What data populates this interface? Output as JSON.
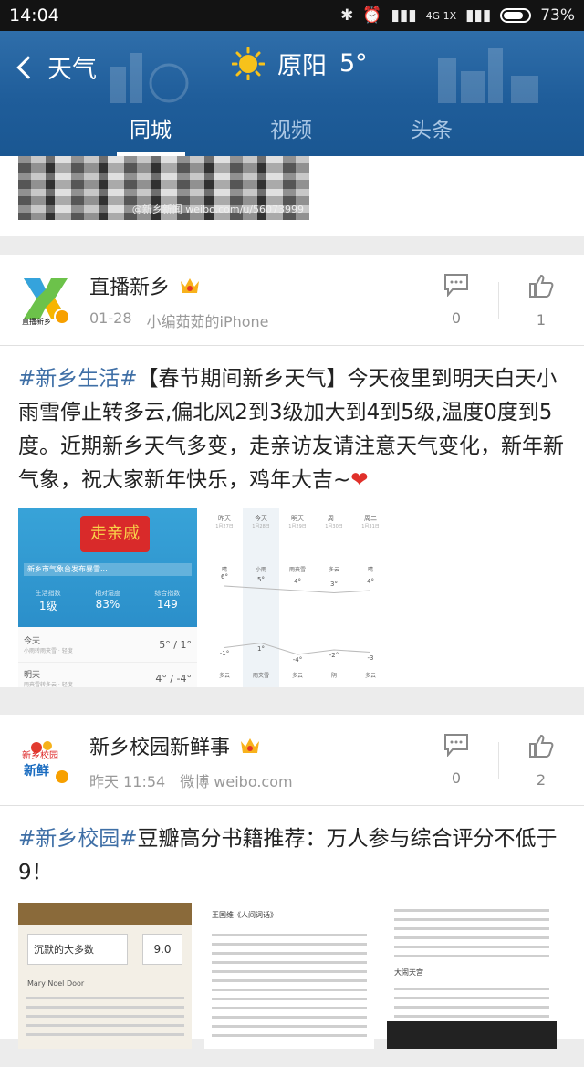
{
  "status_bar": {
    "time": "14:04",
    "network": "4G 1X",
    "battery": "73%"
  },
  "header": {
    "back_label": "天气",
    "city": "原阳",
    "temperature": "5°",
    "tabs": [
      {
        "label": "同城",
        "active": true
      },
      {
        "label": "视频",
        "active": false
      },
      {
        "label": "头条",
        "active": false
      }
    ],
    "accent_color": "#1f5d9a"
  },
  "top_image_watermark": "@新乡新闻  weibo.com/u/56073999",
  "posts": [
    {
      "author": "直播新乡",
      "avatar_text": "直播新乡",
      "date": "01-28",
      "source": "小编茹茹的iPhone",
      "comments": "0",
      "likes": "1",
      "text_tag1": "#新乡生活#",
      "text_main": "【春节期间新乡天气】今天夜里到明天白天小雨雪停止转多云,偏北风2到3级加大到4到5级,温度0度到5度。近期新乡天气多变，走亲访友请注意天气变化，新年新气象，祝大家新年快乐，鸡年大吉~",
      "text_heart": "❤",
      "images": [
        {
          "banner_text": "走亲戚",
          "alert_text": "新乡市气象台发布暴雪...",
          "stats": [
            {
              "label": "生活指数",
              "value": "1级"
            },
            {
              "label": "相对湿度",
              "value": "83%"
            },
            {
              "label": "综合指数",
              "value": "149"
            }
          ],
          "days": [
            {
              "day": "今天",
              "desc": "小雨转雨夹雪 · 轻度",
              "temp": "5° / 1°"
            },
            {
              "day": "明天",
              "desc": "雨夹雪转多云 · 轻度",
              "temp": "4° / -4°"
            }
          ]
        },
        {
          "cols": [
            "昨天",
            "今天",
            "明天",
            "周一",
            "周二"
          ],
          "dates": [
            "1月27日",
            "1月28日",
            "1月29日",
            "1月30日",
            "1月31日"
          ],
          "cond_top": [
            "晴",
            "小雨",
            "雨夹雪",
            "多云",
            "晴"
          ],
          "highs": [
            "6°",
            "5°",
            "4°",
            "3°",
            "4°"
          ],
          "lows": [
            "-1°",
            "1°",
            "-4°",
            "-2°",
            "-3"
          ],
          "cond_bottom": [
            "多云",
            "雨夹雪",
            "多云",
            "阴",
            "多云"
          ]
        }
      ]
    },
    {
      "author": "新乡校园新鲜事",
      "avatar_text": "新鲜",
      "date": "昨天 11:54",
      "source": "微博 weibo.com",
      "comments": "0",
      "likes": "2",
      "text_tag1": "#新乡校园#",
      "text_main": "豆瓣高分书籍推荐：万人参与综合评分不低于9！",
      "images": [
        {
          "title": "沉默的大多数",
          "score": "9.0",
          "caption": "Mary Noel Door"
        },
        {
          "caption": "王国维《人间词话》"
        },
        {
          "caption": "大闹天宫"
        }
      ]
    }
  ]
}
